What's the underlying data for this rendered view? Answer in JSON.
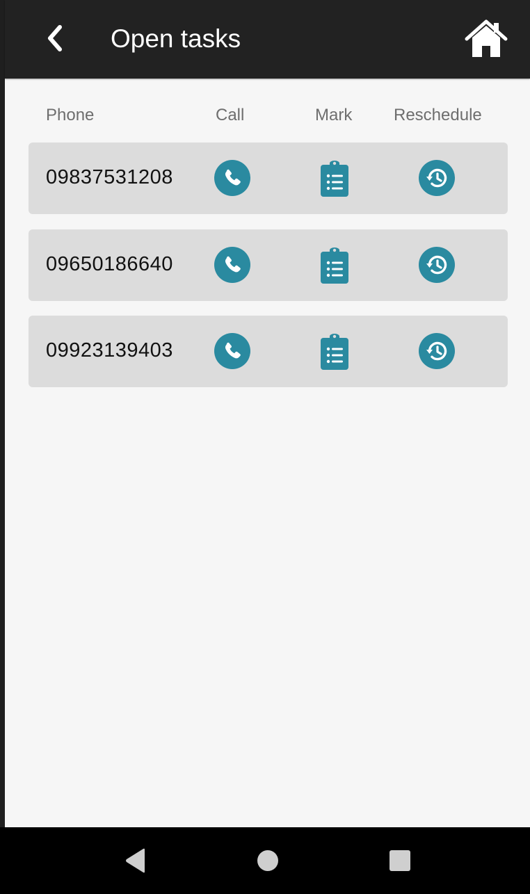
{
  "appbar": {
    "title": "Open tasks",
    "back_icon": "chevron-left-icon",
    "home_icon": "home-icon"
  },
  "columns": {
    "phone": "Phone",
    "call": "Call",
    "mark": "Mark",
    "reschedule": "Reschedule"
  },
  "tasks": [
    {
      "phone": "09837531208"
    },
    {
      "phone": "09650186640"
    },
    {
      "phone": "09923139403"
    }
  ],
  "colors": {
    "accent": "#2a8aa0",
    "appbar": "#222222",
    "row_bg": "#dcdcdc",
    "screen_bg": "#f6f6f6"
  },
  "navbar": {
    "back_icon": "triangle-back-icon",
    "home_icon": "circle-home-icon",
    "recents_icon": "square-recents-icon"
  }
}
